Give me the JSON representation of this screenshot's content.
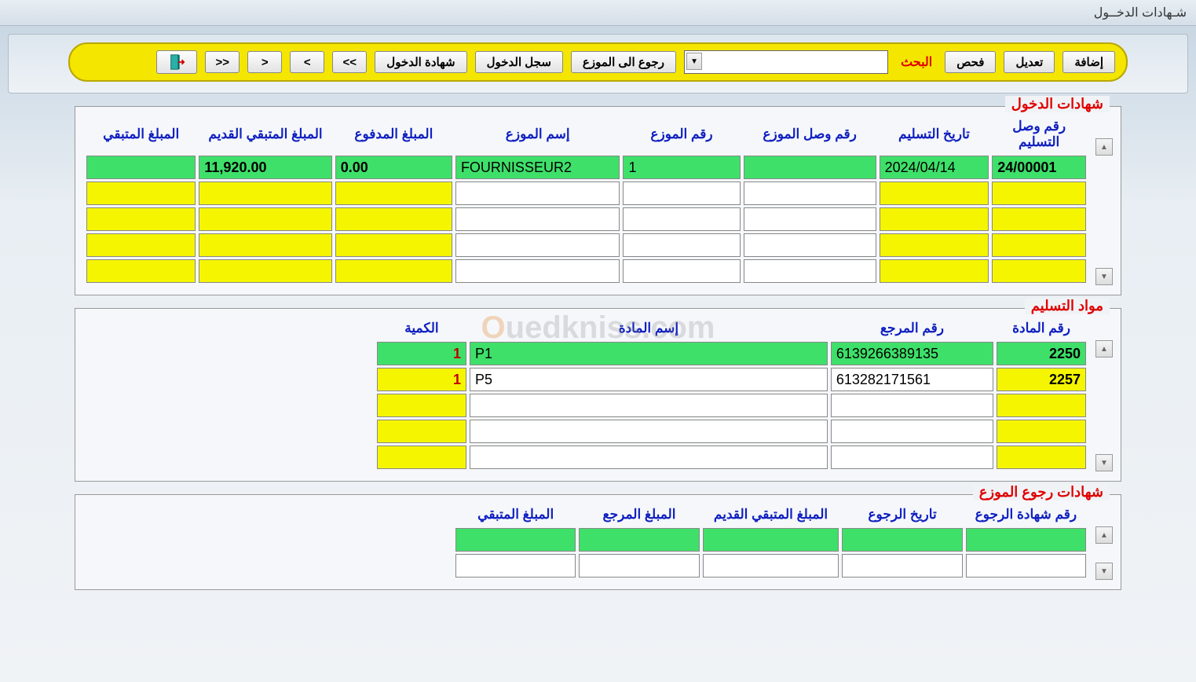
{
  "window": {
    "title": "شـهادات الدخــول"
  },
  "toolbar": {
    "add": "إضافة",
    "edit": "تعديل",
    "check": "فحص",
    "search_label": "البحث",
    "combo_value": "",
    "return_supplier": "رجوع الى الموزع",
    "entry_log": "سجل الدخول",
    "entry_cert": "شهادة الدخول",
    "nav_first": "<<",
    "nav_prev": "<",
    "nav_next": ">",
    "nav_last": ">>"
  },
  "panel1": {
    "title": "شهادات الدخول",
    "headers": {
      "delivery_receipt_no": "رقم وصل التسليم",
      "delivery_date": "تاريخ التسليم",
      "supplier_receipt_no": "رقم وصل الموزع",
      "supplier_no": "رقم الموزع",
      "supplier_name": "إسم الموزع",
      "amount_paid": "المبلغ المدفوع",
      "old_balance": "المبلغ المتبقي القديم",
      "balance": "المبلغ المتبقي"
    },
    "rows": [
      {
        "delivery_receipt_no": "24/00001",
        "delivery_date": "2024/04/14",
        "supplier_receipt_no": "",
        "supplier_no": "1",
        "supplier_name": "FOURNISSEUR2",
        "amount_paid": "0.00",
        "old_balance": "11,920.00",
        "balance": ""
      }
    ]
  },
  "panel2": {
    "title": "مواد التسليم",
    "headers": {
      "product_no": "رقم المادة",
      "reference_no": "رقم المرجع",
      "product_name": "إسم المادة",
      "quantity": "الكمية"
    },
    "rows": [
      {
        "product_no": "2250",
        "reference_no": "6139266389135",
        "product_name": "P1",
        "quantity": "1"
      },
      {
        "product_no": "2257",
        "reference_no": "613282171561",
        "product_name": "P5",
        "quantity": "1"
      }
    ]
  },
  "panel3": {
    "title": "شهادات رجوع الموزع",
    "headers": {
      "return_cert_no": "رقم شهادة الرجوع",
      "return_date": "تاريخ الرجوع",
      "old_balance": "المبلغ المتبقي القديم",
      "returned_amount": "المبلغ المرجع",
      "balance": "المبلغ المتبقي"
    }
  },
  "watermark": {
    "text1": "O",
    "text2": "uedkniss",
    "text3": ".com"
  }
}
